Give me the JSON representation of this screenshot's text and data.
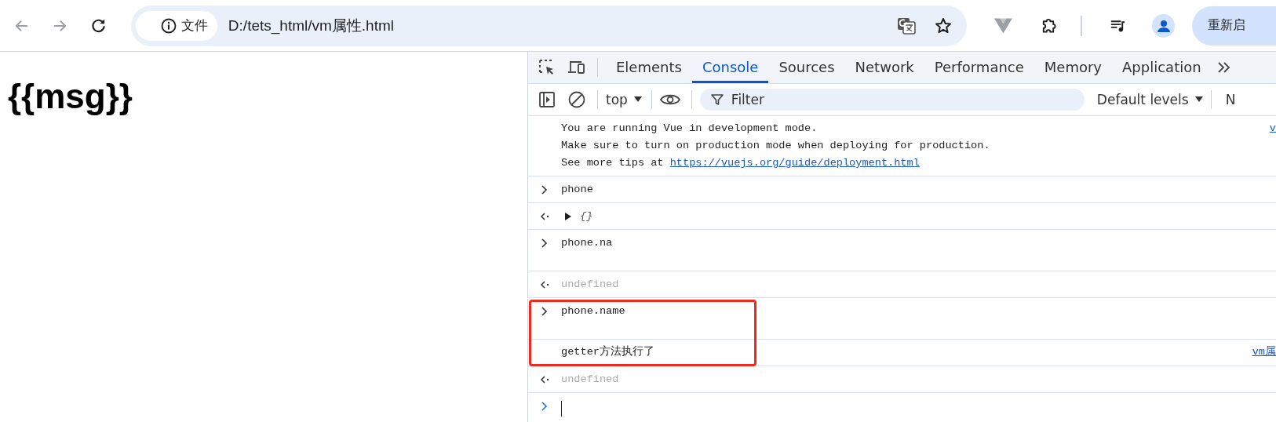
{
  "browser": {
    "nav": [
      {
        "kind": "back",
        "disabled": true
      },
      {
        "kind": "forward",
        "disabled": true
      },
      {
        "kind": "reload",
        "disabled": false
      }
    ],
    "address": {
      "security_label": "文件",
      "url": "D:/tets_html/vm属性.html"
    },
    "relaunch_button": "重新启"
  },
  "page": {
    "heading": "{{msg}}"
  },
  "devtools": {
    "tabs": [
      {
        "label": "Elements",
        "selected": false
      },
      {
        "label": "Console",
        "selected": true
      },
      {
        "label": "Sources",
        "selected": false
      },
      {
        "label": "Network",
        "selected": false
      },
      {
        "label": "Performance",
        "selected": false
      },
      {
        "label": "Memory",
        "selected": false
      },
      {
        "label": "Application",
        "selected": false
      }
    ],
    "console_toolbar": {
      "context": "top",
      "filter_placeholder": "Filter",
      "levels": "Default levels",
      "issues": "N"
    },
    "messages": [
      {
        "kind": "log",
        "lines": [
          "You are running Vue in development mode.",
          "Make sure to turn on production mode when deploying for production.",
          "See more tips at "
        ],
        "link": "https://vuejs.org/guide/deployment.html",
        "source": "v"
      },
      {
        "kind": "input",
        "text": "phone",
        "multiline": false
      },
      {
        "kind": "result",
        "text": "{}",
        "expandable": true
      },
      {
        "kind": "input",
        "text": "phone.na",
        "multiline": true
      },
      {
        "kind": "result",
        "text": "undefined",
        "expandable": false
      },
      {
        "kind": "input",
        "text": "phone.name",
        "multiline": true
      },
      {
        "kind": "log",
        "lines": [
          "getter方法执行了"
        ],
        "source": "vm属"
      },
      {
        "kind": "result",
        "text": "undefined",
        "expandable": false
      }
    ],
    "prompt": {
      "caret": true
    }
  },
  "annotations": [
    {
      "kind": "box"
    }
  ]
}
